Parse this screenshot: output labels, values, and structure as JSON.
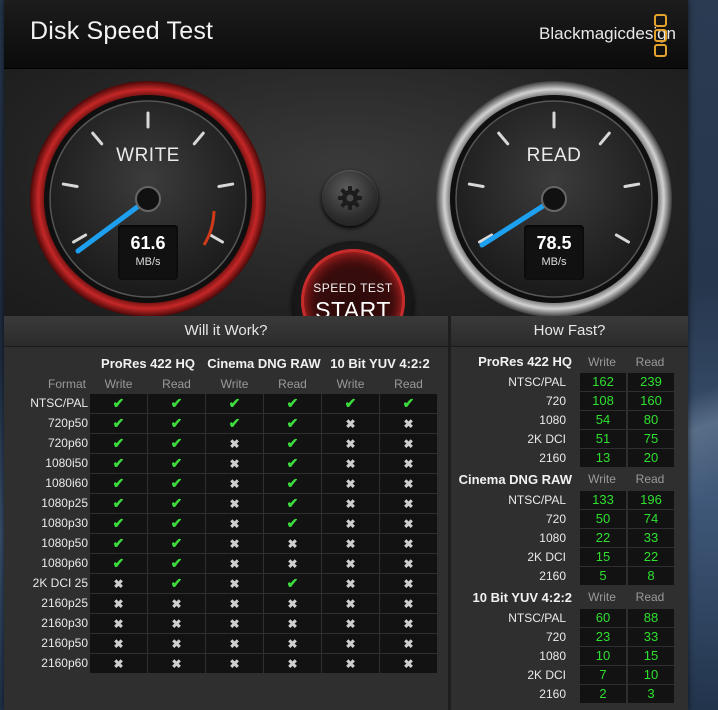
{
  "window": {
    "title": "Disk Speed Test",
    "brand": "Blackmagicdesign"
  },
  "gauges": {
    "write": {
      "label": "WRITE",
      "value": "61.6",
      "unit": "MB/s"
    },
    "read": {
      "label": "READ",
      "value": "78.5",
      "unit": "MB/s"
    }
  },
  "controls": {
    "start_top": "SPEED TEST",
    "start_main": "START"
  },
  "will": {
    "heading": "Will it Work?",
    "groups": [
      "ProRes 422 HQ",
      "Cinema DNG RAW",
      "10 Bit YUV 4:2:2"
    ],
    "format_label": "Format",
    "write_label": "Write",
    "read_label": "Read",
    "rows": [
      {
        "label": "NTSC/PAL",
        "cells": [
          true,
          true,
          true,
          true,
          true,
          true
        ]
      },
      {
        "label": "720p50",
        "cells": [
          true,
          true,
          true,
          true,
          false,
          false
        ]
      },
      {
        "label": "720p60",
        "cells": [
          true,
          true,
          false,
          true,
          false,
          false
        ]
      },
      {
        "label": "1080i50",
        "cells": [
          true,
          true,
          false,
          true,
          false,
          false
        ]
      },
      {
        "label": "1080i60",
        "cells": [
          true,
          true,
          false,
          true,
          false,
          false
        ]
      },
      {
        "label": "1080p25",
        "cells": [
          true,
          true,
          false,
          true,
          false,
          false
        ]
      },
      {
        "label": "1080p30",
        "cells": [
          true,
          true,
          false,
          true,
          false,
          false
        ]
      },
      {
        "label": "1080p50",
        "cells": [
          true,
          true,
          false,
          false,
          false,
          false
        ]
      },
      {
        "label": "1080p60",
        "cells": [
          true,
          true,
          false,
          false,
          false,
          false
        ]
      },
      {
        "label": "2K DCI 25",
        "cells": [
          false,
          true,
          false,
          true,
          false,
          false
        ]
      },
      {
        "label": "2160p25",
        "cells": [
          false,
          false,
          false,
          false,
          false,
          false
        ]
      },
      {
        "label": "2160p30",
        "cells": [
          false,
          false,
          false,
          false,
          false,
          false
        ]
      },
      {
        "label": "2160p50",
        "cells": [
          false,
          false,
          false,
          false,
          false,
          false
        ]
      },
      {
        "label": "2160p60",
        "cells": [
          false,
          false,
          false,
          false,
          false,
          false
        ]
      }
    ]
  },
  "fast": {
    "heading": "How Fast?",
    "write_label": "Write",
    "read_label": "Read",
    "groups": [
      {
        "title": "ProRes 422 HQ",
        "rows": [
          {
            "label": "NTSC/PAL",
            "write": "162",
            "read": "239"
          },
          {
            "label": "720",
            "write": "108",
            "read": "160"
          },
          {
            "label": "1080",
            "write": "54",
            "read": "80"
          },
          {
            "label": "2K DCI",
            "write": "51",
            "read": "75"
          },
          {
            "label": "2160",
            "write": "13",
            "read": "20"
          }
        ]
      },
      {
        "title": "Cinema DNG RAW",
        "rows": [
          {
            "label": "NTSC/PAL",
            "write": "133",
            "read": "196"
          },
          {
            "label": "720",
            "write": "50",
            "read": "74"
          },
          {
            "label": "1080",
            "write": "22",
            "read": "33"
          },
          {
            "label": "2K DCI",
            "write": "15",
            "read": "22"
          },
          {
            "label": "2160",
            "write": "5",
            "read": "8"
          }
        ]
      },
      {
        "title": "10 Bit YUV 4:2:2",
        "rows": [
          {
            "label": "NTSC/PAL",
            "write": "60",
            "read": "88"
          },
          {
            "label": "720",
            "write": "23",
            "read": "33"
          },
          {
            "label": "1080",
            "write": "10",
            "read": "15"
          },
          {
            "label": "2K DCI",
            "write": "7",
            "read": "10"
          },
          {
            "label": "2160",
            "write": "2",
            "read": "3"
          }
        ]
      }
    ]
  },
  "colors": {
    "accent_blue": "#1ea0f0",
    "write_ring": "#b02020",
    "ok_green": "#3ddb3d",
    "number_green": "#2fe02f",
    "brand_orange": "#e3a12d"
  },
  "icons": {
    "settings": "gear-icon",
    "yes": "check-icon",
    "no": "cross-icon"
  }
}
